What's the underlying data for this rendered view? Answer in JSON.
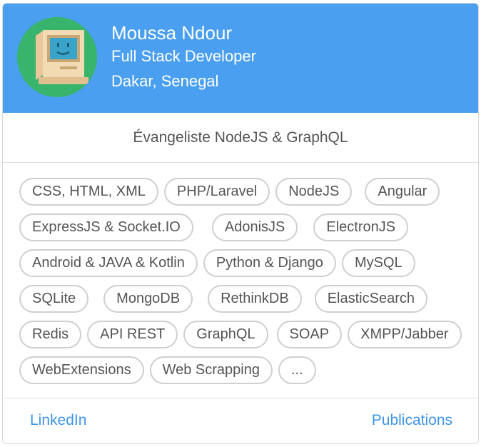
{
  "profile": {
    "name": "Moussa Ndour",
    "role": "Full Stack Developer",
    "location": "Dakar, Senegal",
    "avatar_icon": "retro-computer-icon"
  },
  "tagline": "Évangeliste NodeJS & GraphQL",
  "skills": [
    [
      "CSS, HTML, XML",
      "PHP/Laravel",
      "NodeJS",
      "Angular"
    ],
    [
      "ExpressJS & Socket.IO",
      "AdonisJS",
      "ElectronJS"
    ],
    [
      "Android & JAVA & Kotlin",
      "Python & Django",
      "MySQL"
    ],
    [
      "SQLite",
      "MongoDB",
      "RethinkDB",
      "ElasticSearch"
    ],
    [
      "Redis",
      "API REST",
      "GraphQL",
      "SOAP",
      "XMPP/Jabber"
    ],
    [
      "WebExtensions",
      "Web Scrapping",
      "..."
    ]
  ],
  "links": {
    "left": "LinkedIn",
    "right": "Publications"
  },
  "colors": {
    "header": "#4a9ff0",
    "avatar_bg": "#39b46c",
    "link": "#3e95e8",
    "chip_border": "#cfcfcf",
    "text": "#555555"
  }
}
